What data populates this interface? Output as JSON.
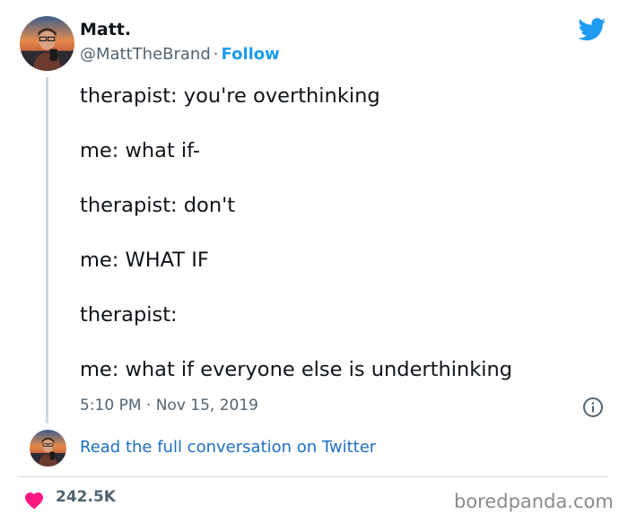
{
  "author": {
    "display_name": "Matt.",
    "handle": "@MattTheBrand",
    "separator": "·",
    "follow_label": "Follow"
  },
  "tweet": {
    "lines": [
      "therapist: you're overthinking",
      "me: what if-",
      "therapist: don't",
      "me: WHAT IF",
      "therapist:",
      "me: what if everyone else is underthinking"
    ],
    "timestamp": "5:10 PM · Nov 15, 2019"
  },
  "conversation_link": "Read the full conversation on Twitter",
  "engagement": {
    "likes": "242.5K"
  },
  "watermark": "boredpanda.com",
  "icons": {
    "brand": "twitter-bird-icon",
    "info": "info-icon",
    "like": "heart-icon"
  },
  "colors": {
    "twitter_blue": "#1d9bf0",
    "heart_pink": "#f91880",
    "secondary_text": "#536471",
    "primary_text": "#0f1419"
  }
}
